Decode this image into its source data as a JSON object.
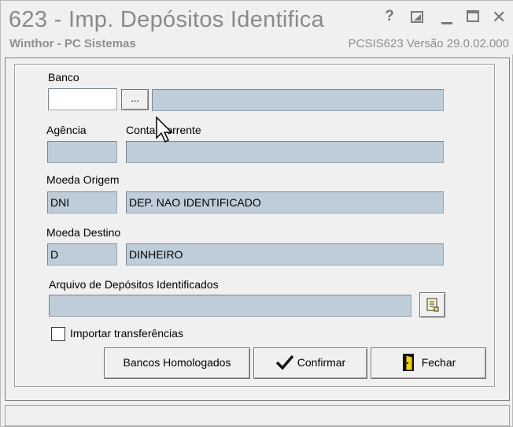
{
  "window": {
    "title": "623 - Imp. Depósitos Identifica",
    "app_name": "Winthor - PC Sistemas",
    "version_info": "PCSIS623  Versão  29.0.02.000",
    "controls": {
      "help": "?",
      "close": "✕"
    }
  },
  "form": {
    "banco": {
      "label": "Banco",
      "code_value": "",
      "browse_label": "...",
      "name_value": ""
    },
    "agencia": {
      "label": "Agência",
      "value": ""
    },
    "conta_corrente": {
      "label": "Conta Corrente",
      "value": ""
    },
    "moeda_origem": {
      "label": "Moeda Origem",
      "code": "DNI",
      "description": "DEP. NAO IDENTIFICADO"
    },
    "moeda_destino": {
      "label": "Moeda Destino",
      "code": "D",
      "description": "DINHEIRO"
    },
    "arquivo": {
      "label": "Arquivo de Depósitos Identificados",
      "value": "",
      "browse_icon": "open-file-icon"
    },
    "importar_transferencias": {
      "label": "Importar transferências",
      "checked": false
    }
  },
  "buttons": {
    "bancos_homologados": "Bancos Homologados",
    "confirmar": "Confirmar",
    "fechar": "Fechar"
  },
  "status_bar": {
    "text": ""
  }
}
